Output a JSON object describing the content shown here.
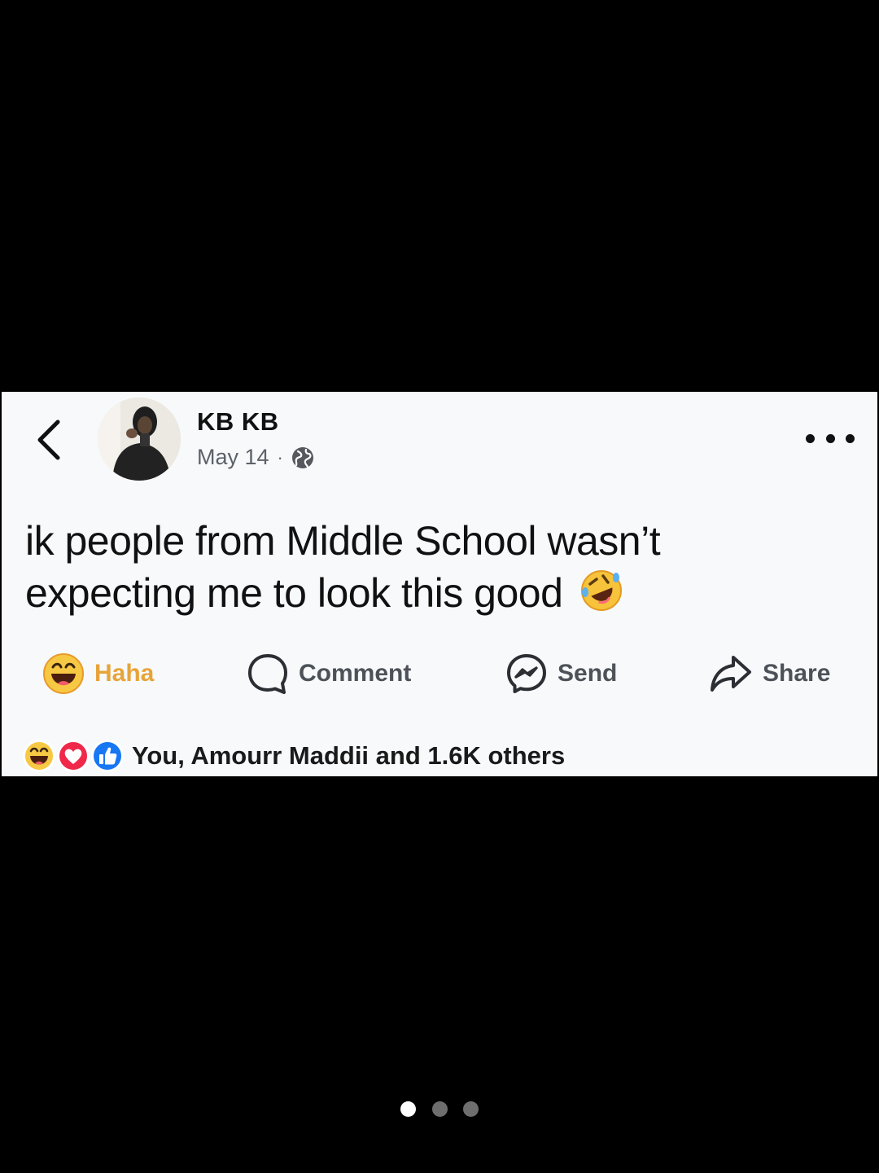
{
  "post": {
    "author": "KB KB",
    "date": "May 14",
    "separator": "·",
    "text": "ik people from Middle School wasn’t expecting me to look this good",
    "emoji": "rolling-on-floor-laughing-emoji"
  },
  "icons": {
    "back": "chevron-left-icon",
    "more": "more-horizontal-icon",
    "privacy": "globe-icon",
    "comment": "comment-bubble-icon",
    "send": "messenger-icon",
    "share": "share-arrow-icon"
  },
  "actions": {
    "haha_label": "Haha",
    "comment_label": "Comment",
    "send_label": "Send",
    "share_label": "Share"
  },
  "reactions": {
    "types": [
      "haha",
      "love",
      "like"
    ],
    "summary": "You, Amourr Maddii and 1.6K others"
  },
  "pager": {
    "count": 3,
    "active_index": 0
  },
  "colors": {
    "background": "#000000",
    "card": "#f7f9fb",
    "haha_accent": "#e7a43a",
    "like_blue": "#1877f2",
    "love_red": "#f0284a",
    "text": "#111111",
    "muted": "#5d6168"
  }
}
